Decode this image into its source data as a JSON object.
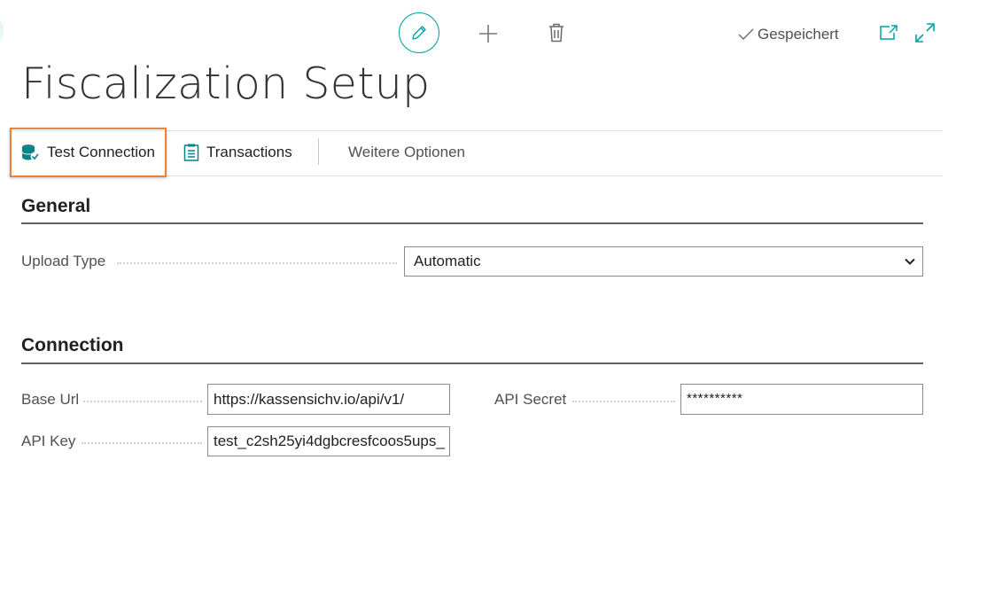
{
  "toolbar": {
    "saved_label": "Gespeichert",
    "icons": [
      "edit-pencil-icon",
      "plus-icon",
      "trash-icon",
      "checkmark-icon",
      "open-new-window-icon",
      "expand-icon"
    ]
  },
  "page": {
    "title": "Fiscalization Setup"
  },
  "actions": {
    "test_connection": "Test Connection",
    "transactions": "Transactions",
    "more_options": "Weitere Optionen"
  },
  "general": {
    "title": "General",
    "upload_type_label": "Upload Type",
    "upload_type_value": "Automatic"
  },
  "connection": {
    "title": "Connection",
    "base_url_label": "Base Url",
    "base_url_value": "https://kassensichv.io/api/v1/",
    "api_key_label": "API Key",
    "api_key_value": "test_c2sh25yi4dgbcresfcoos5ups_",
    "api_secret_label": "API Secret",
    "api_secret_value": "**********"
  },
  "colors": {
    "accent": "#00a4a6",
    "highlight": "#e8823c"
  }
}
